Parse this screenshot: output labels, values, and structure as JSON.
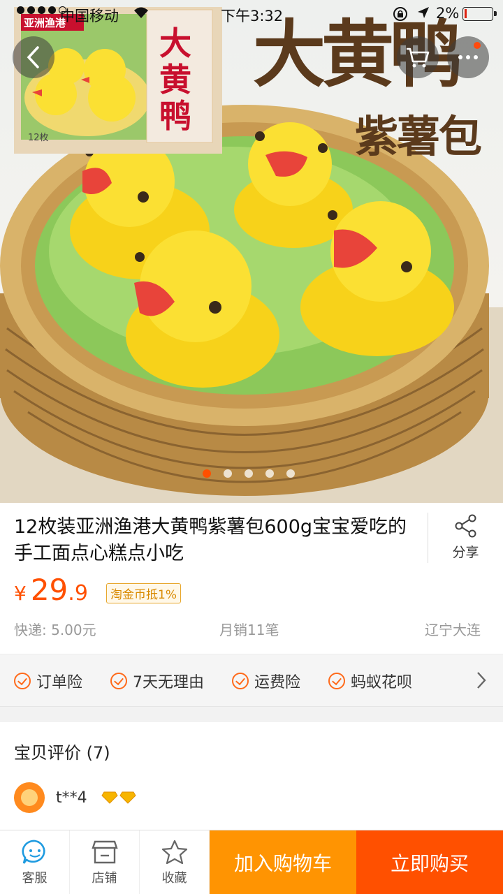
{
  "status_bar": {
    "carrier": "中国移动",
    "time": "下午3:32",
    "battery": "2%"
  },
  "hero": {
    "package_brand": "亚洲渔港",
    "package_title": "大黄鸭",
    "package_count": "12枚",
    "headline": "大黄鸭",
    "subheadline": "紫薯包",
    "page_count": 5,
    "current_page": 1
  },
  "product": {
    "title": "12枚装亚洲渔港大黄鸭紫薯包600g宝宝爱吃的手工面点心糕点小吃",
    "share_label": "分享",
    "currency": "¥",
    "price_int": "29",
    "price_dec": ".9",
    "coin_badge": "淘金币抵1%",
    "shipping": "快递: 5.00元",
    "monthly_sales": "月销11笔",
    "location": "辽宁大连"
  },
  "services": [
    "订单险",
    "7天无理由",
    "运费险",
    "蚂蚁花呗"
  ],
  "reviews": {
    "heading": "宝贝评价 (7)",
    "user": "t**4"
  },
  "bottom_bar": {
    "service_label": "客服",
    "shop_label": "店铺",
    "favorite_label": "收藏",
    "add_to_cart": "加入购物车",
    "buy_now": "立即购买"
  },
  "colors": {
    "accent": "#ff5000",
    "cart_button": "#ff9402",
    "buy_button": "#ff5000",
    "coin_badge": "#e8a72d"
  }
}
